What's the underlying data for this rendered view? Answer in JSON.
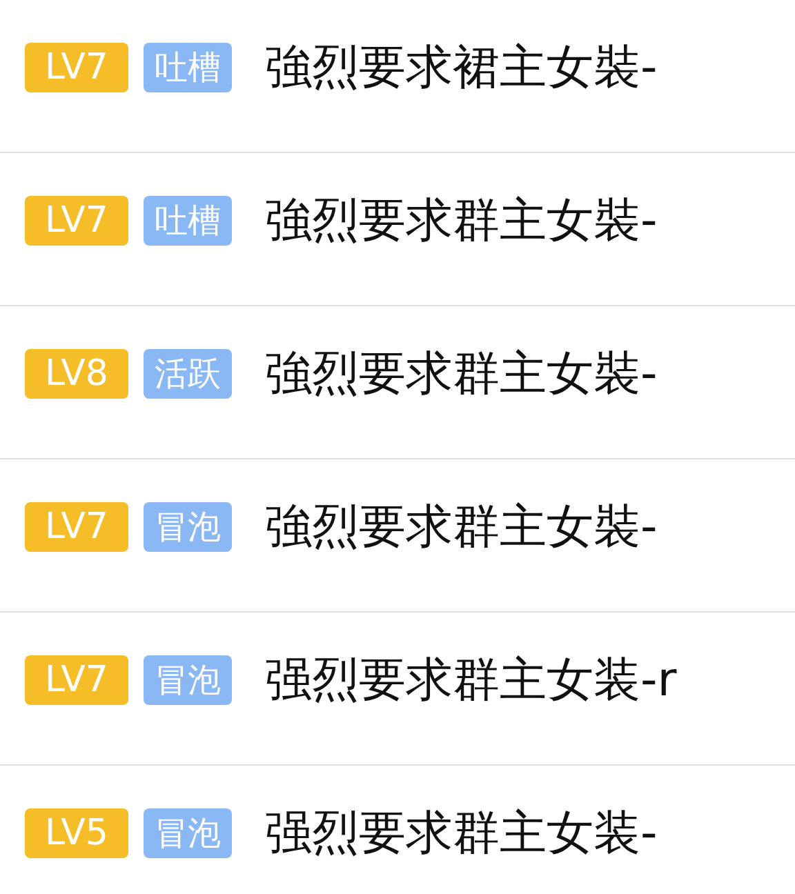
{
  "rows": [
    {
      "level": "LV7",
      "tag": "吐槽",
      "title": "強烈要求裙主女裝-"
    },
    {
      "level": "LV7",
      "tag": "吐槽",
      "title": "強烈要求群主女裝-"
    },
    {
      "level": "LV8",
      "tag": "活跃",
      "title": "強烈要求群主女裝-"
    },
    {
      "level": "LV7",
      "tag": "冒泡",
      "title": "強烈要求群主女裝-"
    },
    {
      "level": "LV7",
      "tag": "冒泡",
      "title": "强烈要求群主女装-r"
    },
    {
      "level": "LV5",
      "tag": "冒泡",
      "title": "强烈要求群主女装-"
    }
  ]
}
